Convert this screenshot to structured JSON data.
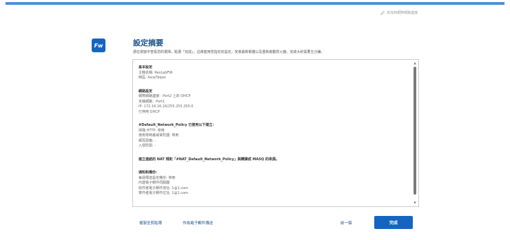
{
  "colors": {
    "accent": "#1565c0",
    "topbar": "#4a8fd8",
    "title": "#1d4f91"
  },
  "header": {
    "help_link": "未找到網際網路連接",
    "help_icon": "pencil-icon"
  },
  "logo": {
    "text": "Fw"
  },
  "page": {
    "title": "設定摘要",
    "subtitle": "請在視窗中查看您的選擇。點選「完成」，這將套用您指定的設定。安裝最新韌體以及重新啟動防火牆。完成大約需要五分鐘。"
  },
  "summary": {
    "basic": {
      "heading": "基本設定",
      "lines": [
        "主機名稱: RexLabFW",
        "時區: Asia/Taipei"
      ]
    },
    "network": {
      "heading": "網路設定",
      "lines": [
        "網際網路連接：Port2 上的 DHCP",
        "本機網路：Port1",
        "IP: 172.16.16.16/255.255.255.0",
        "已停用 DHCP"
      ]
    },
    "policy": {
      "heading": "#Default_Network_Policy 已使用以下建立：",
      "lines": [
        "掃描 HTTP: 停用",
        "使用零時差威脅防護: 停用",
        "網頁政策: -",
        "入侵防禦: -"
      ]
    },
    "nat": {
      "heading": "建立連結的 NAT 規則「#NAT_Default_Network_Policy」與轉譯成 MASQ 的來源。"
    },
    "notify": {
      "heading": "通知和備份:",
      "lines": [
        "每週傳送設定備份: 停用",
        "內建電子郵件伺服器",
        "收件者電子郵件地址: 1@1.com",
        "寄件者電子郵件位址: 1@1.com"
      ]
    }
  },
  "footer": {
    "copy_label": "複製至剪貼簿",
    "email_label": "作為電子郵件傳送",
    "back_label": "前一個",
    "done_label": "完成"
  }
}
